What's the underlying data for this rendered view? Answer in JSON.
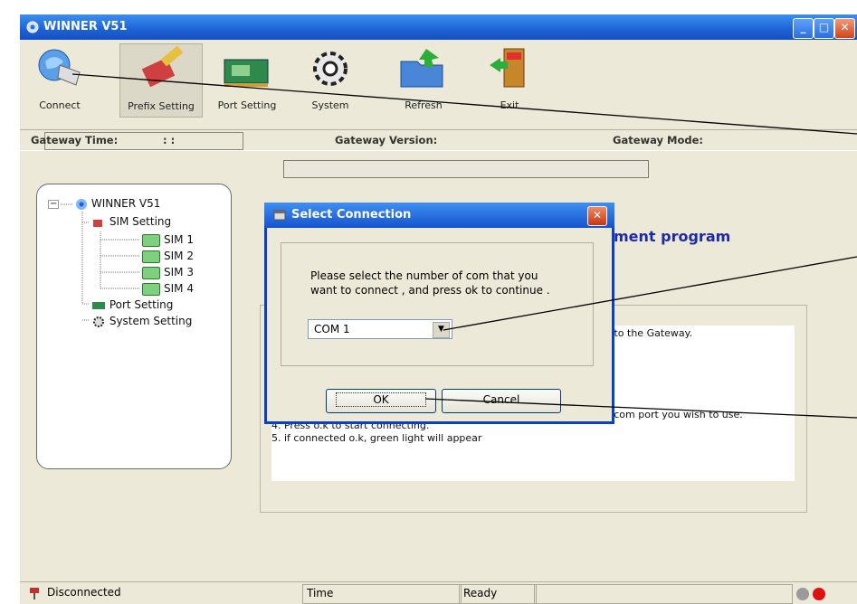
{
  "window": {
    "title": "WINNER V51"
  },
  "toolbar": [
    {
      "label": "Connect",
      "icon": "connect-icon"
    },
    {
      "label": "Prefix Setting",
      "icon": "prefix-setting-icon"
    },
    {
      "label": "Port Setting",
      "icon": "port-setting-icon"
    },
    {
      "label": "System",
      "icon": "gear-icon"
    },
    {
      "label": "Refresh",
      "icon": "refresh-folder-icon"
    },
    {
      "label": "Exit",
      "icon": "exit-door-icon"
    }
  ],
  "gateway": {
    "time_label": "Gateway Time:",
    "time_value": ":   :",
    "version_label": "Gateway Version:",
    "mode_label": "Gateway Mode:"
  },
  "tree": {
    "root": "WINNER V51",
    "sim_setting": "SIM Setting",
    "sims": [
      "SIM 1",
      "SIM 2",
      "SIM 3",
      "SIM 4"
    ],
    "port_setting": "Port Setting",
    "system_setting": "System Setting"
  },
  "main": {
    "heading_fragment": "ment program",
    "instr_right_1": "d to the Gateway.",
    "instr_right_2": "e com port you wish to use.",
    "instr_4": "4. Press o.k to start connecting.",
    "instr_5": "5. if connected o.k, green light will appear"
  },
  "dialog": {
    "title": "Select Connection",
    "message_line1": "Please select the number of com that you",
    "message_line2": "want to connect , and press ok to continue .",
    "combo_value": "COM 1",
    "ok_label": "OK",
    "cancel_label": "Cancel"
  },
  "statusbar": {
    "connection": "Disconnected",
    "time": "Time",
    "state": "Ready"
  },
  "colors": {
    "titlebar": "#1d62d6",
    "heading": "#1d2aa8",
    "light_off": "#9a9a9a",
    "light_on": "#e01010"
  }
}
